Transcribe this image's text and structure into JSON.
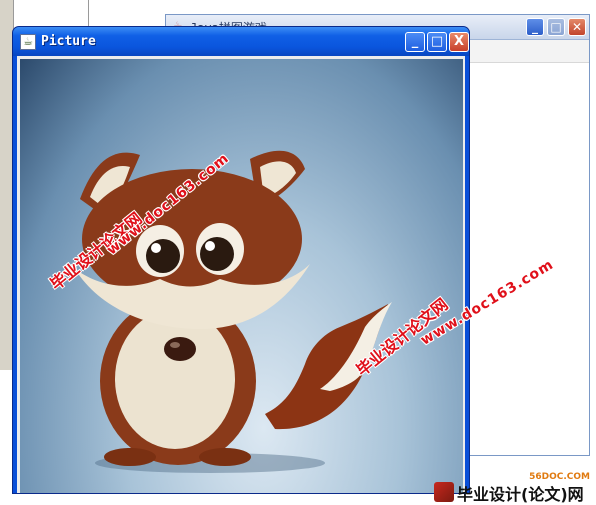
{
  "background_window": {
    "title": "Java拼图游戏",
    "title_icon": "java-coffee-icon"
  },
  "picture_window": {
    "title": "Picture",
    "title_icon": "picture-icon",
    "buttons": {
      "minimize": "_",
      "maximize": "□",
      "close": "X"
    }
  },
  "image": {
    "subject": "cartoon fox",
    "background_color": "#7fa3c4"
  },
  "watermarks": {
    "site_name": "毕业设计论文网",
    "url": "www.doc163.com"
  },
  "logo": {
    "url": "56DOC.COM",
    "text": "毕业设计(论文)网"
  },
  "colors": {
    "xp_title_blue": "#0a55dd",
    "close_red": "#c8402a",
    "watermark_red": "#e0101a"
  }
}
